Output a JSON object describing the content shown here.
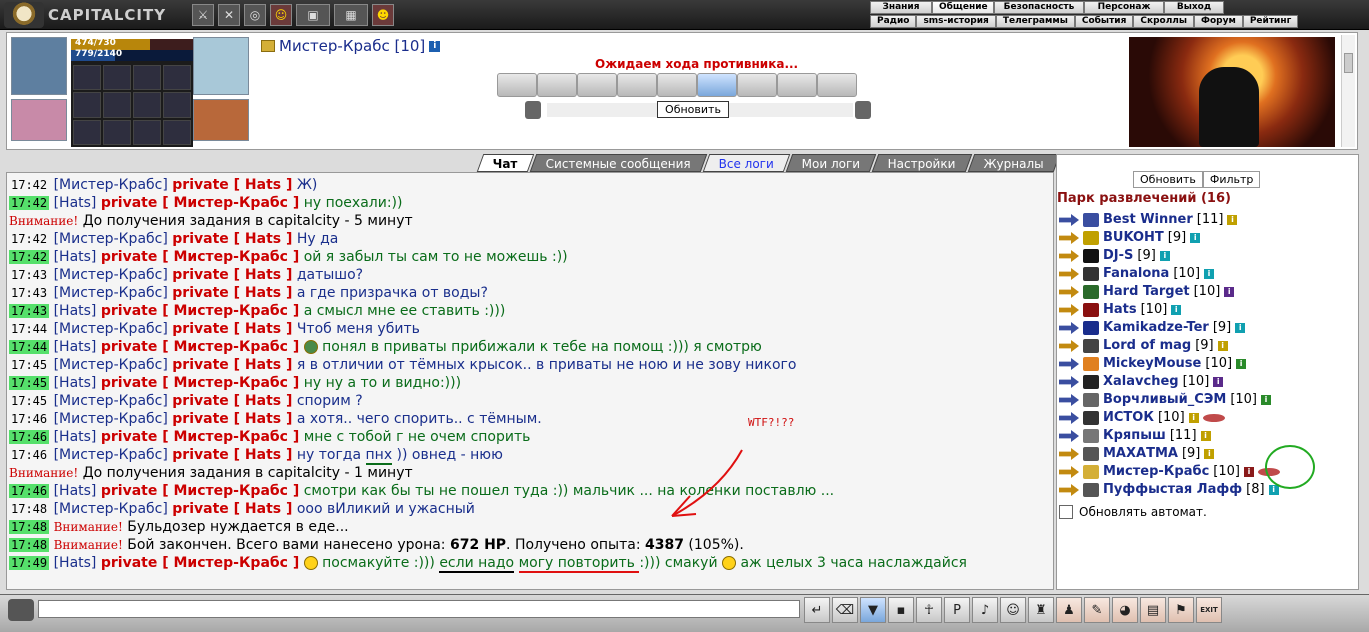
{
  "app": {
    "title": "CAPITALCITY"
  },
  "top_icons": [
    "sword-icon",
    "swords-icon",
    "wheel-icon",
    "smile-icon",
    "portrait-icon",
    "map-icon",
    "character-icon"
  ],
  "nav_row1": [
    {
      "label": "Знания"
    },
    {
      "label": "Общение",
      "active": true
    },
    {
      "label": "Безопасность"
    },
    {
      "label": "Персонаж"
    },
    {
      "label": "Выход"
    }
  ],
  "nav_row2": [
    {
      "label": "Радио"
    },
    {
      "label": "sms-история"
    },
    {
      "label": "Телеграммы"
    },
    {
      "label": "События"
    },
    {
      "label": "Скроллы"
    },
    {
      "label": "Форум"
    },
    {
      "label": "Рейтинг"
    }
  ],
  "character": {
    "hp": "474/730",
    "hp_fraction": 0.65,
    "mp": "779/2140",
    "mp_fraction": 0.36,
    "nick": "Мистер-Крабс [10]",
    "info": "i"
  },
  "battle": {
    "status": "Ожидаем хода противника...",
    "refresh_label": "Обновить"
  },
  "tabs": [
    {
      "label": "Чат",
      "active": true
    },
    {
      "label": "Системные сообщения"
    },
    {
      "label": "Все логи",
      "blue": true
    },
    {
      "label": "Мои логи"
    },
    {
      "label": "Настройки"
    },
    {
      "label": "Журналы"
    }
  ],
  "chat": [
    {
      "type": "msg",
      "time": "17:42",
      "hl": false,
      "from": "[Мистер-Крабс]",
      "to": "private [ Hats ]",
      "text": "Ж)",
      "color": "blue"
    },
    {
      "type": "msg",
      "time": "17:42",
      "hl": true,
      "from": "[Hats]",
      "to": "private [ Мистер-Крабс ]",
      "text": "ну поехали:))",
      "color": "green"
    },
    {
      "type": "sys",
      "attn": "Внимание!",
      "text": "До получения задания в capitalcity - 5 минут"
    },
    {
      "type": "msg",
      "time": "17:42",
      "hl": false,
      "from": "[Мистер-Крабс]",
      "to": "private [ Hats ]",
      "text": "Ну да",
      "color": "blue"
    },
    {
      "type": "msg",
      "time": "17:42",
      "hl": true,
      "from": "[Hats]",
      "to": "private [ Мистер-Крабс ]",
      "text": "ой я забыл ты сам то не можешь :))",
      "color": "green"
    },
    {
      "type": "msg",
      "time": "17:43",
      "hl": false,
      "from": "[Мистер-Крабс]",
      "to": "private [ Hats ]",
      "text": "датышо?",
      "color": "blue"
    },
    {
      "type": "msg",
      "time": "17:43",
      "hl": false,
      "from": "[Мистер-Крабс]",
      "to": "private [ Hats ]",
      "text": "а где призрачка от воды?",
      "color": "blue"
    },
    {
      "type": "msg",
      "time": "17:43",
      "hl": true,
      "from": "[Hats]",
      "to": "private [ Мистер-Крабс ]",
      "text": "а смысл мне ее ставить :)))",
      "color": "green"
    },
    {
      "type": "msg",
      "time": "17:44",
      "hl": false,
      "from": "[Мистер-Крабс]",
      "to": "private [ Hats ]",
      "text": "Чтоб меня убить",
      "color": "blue"
    },
    {
      "type": "msg",
      "time": "17:44",
      "hl": true,
      "from": "[Hats]",
      "to": "private [ Мистер-Крабс ]",
      "text": "понял в приваты прибижали к тебе на помощ :))) я смотрю",
      "color": "green",
      "emo": "dark"
    },
    {
      "type": "msg",
      "time": "17:45",
      "hl": false,
      "from": "[Мистер-Крабс]",
      "to": "private [ Hats ]",
      "text": "я в отличии от тёмных крысок.. в приваты не ною и не зову никого",
      "color": "blue"
    },
    {
      "type": "msg",
      "time": "17:45",
      "hl": true,
      "from": "[Hats]",
      "to": "private [ Мистер-Крабс ]",
      "text": "ну ну а то и видно:)))",
      "color": "green"
    },
    {
      "type": "msg",
      "time": "17:45",
      "hl": false,
      "from": "[Мистер-Крабс]",
      "to": "private [ Hats ]",
      "text": "спорим ?",
      "color": "blue"
    },
    {
      "type": "msg",
      "time": "17:46",
      "hl": false,
      "from": "[Мистер-Крабс]",
      "to": "private [ Hats ]",
      "text": "а хотя.. чего спорить.. с тёмным.",
      "color": "blue"
    },
    {
      "type": "msg",
      "time": "17:46",
      "hl": true,
      "from": "[Hats]",
      "to": "private [ Мистер-Крабс ]",
      "text": "мне с тобой г не очем спорить",
      "color": "green"
    },
    {
      "type": "msg",
      "time": "17:46",
      "hl": false,
      "from": "[Мистер-Крабс]",
      "to": "private [ Hats ]",
      "text_pre": "ну тогда ",
      "text_u": "пнх",
      "text_post": " )) овнед - нюю",
      "u": "green",
      "color": "blue"
    },
    {
      "type": "sys",
      "attn": "Внимание!",
      "text": "До получения задания в capitalcity - 1 минут"
    },
    {
      "type": "msg",
      "time": "17:46",
      "hl": true,
      "from": "[Hats]",
      "to": "private [ Мистер-Крабс ]",
      "text": "смотри как бы ты не пошел туда :)) мальчик ... на коленки поставлю ...",
      "color": "green"
    },
    {
      "type": "msg",
      "time": "17:48",
      "hl": false,
      "from": "[Мистер-Крабс]",
      "to": "private [ Hats ]",
      "text": "ооо вИликий и ужасный",
      "color": "blue"
    },
    {
      "type": "warn",
      "time": "17:48",
      "attn": "Внимание!",
      "text": "Бульдозер нуждается в еде..."
    },
    {
      "type": "battle",
      "time": "17:48",
      "attn": "Внимание!",
      "text_pre": "Бой закончен. Всего вами нанесено урона: ",
      "dmg": "672 HP",
      "text_mid": ". Получено опыта: ",
      "exp": "4387",
      "text_post": " (105%)."
    },
    {
      "type": "last",
      "time": "17:49",
      "from": "[Hats]",
      "to": "private [ Мистер-Крабс ]",
      "p1": " посмакуйте :))) ",
      "p2": "если надо",
      "p3": " ",
      "p4": "могу повторить ",
      "p5": ":))) смакуй ",
      "p6": " аж целых 3 часа наслаждайся"
    }
  ],
  "annotation": {
    "text": "WTF?!??"
  },
  "right_panel": {
    "refresh_label": "Обновить",
    "filter_label": "Фильтр",
    "room_title": "Парк развлечений (16)",
    "auto_refresh_label": "Обновлять автомат.",
    "users": [
      {
        "name": "Best Winner",
        "level": "[11]",
        "arrow": "blue",
        "badge": "y"
      },
      {
        "name": "BUKOHT",
        "level": "[9]",
        "arrow": "gold",
        "badge": "c"
      },
      {
        "name": "DJ-S",
        "level": "[9]",
        "arrow": "gold",
        "badge": "c"
      },
      {
        "name": "Fanalona",
        "level": "[10]",
        "arrow": "gold",
        "badge": "c"
      },
      {
        "name": "Hard Target",
        "level": "[10]",
        "arrow": "gold",
        "badge": "p"
      },
      {
        "name": "Hats",
        "level": "[10]",
        "arrow": "gold",
        "badge": "c"
      },
      {
        "name": "Kamikadze-Ter",
        "level": "[9]",
        "arrow": "blue",
        "badge": "c"
      },
      {
        "name": "Lord of mag",
        "level": "[9]",
        "arrow": "gold",
        "badge": "y"
      },
      {
        "name": "MickeyMouse",
        "level": "[10]",
        "arrow": "blue",
        "badge": "g"
      },
      {
        "name": "Xalavcheg",
        "level": "[10]",
        "arrow": "blue",
        "badge": "p"
      },
      {
        "name": "Ворчливый_СЭМ",
        "level": "[10]",
        "arrow": "blue",
        "badge": "g"
      },
      {
        "name": "ИСТОК",
        "level": "[10]",
        "arrow": "blue",
        "badge": "y"
      },
      {
        "name": "Кряпыш",
        "level": "[11]",
        "arrow": "blue",
        "badge": "y"
      },
      {
        "name": "МАХАТМА",
        "level": "[9]",
        "arrow": "gold",
        "badge": "y"
      },
      {
        "name": "Мистер-Крабс",
        "level": "[10]",
        "arrow": "gold",
        "badge": "r"
      },
      {
        "name": "Пуффыстая Лафф",
        "level": "[8]",
        "arrow": "gold",
        "badge": "c"
      }
    ]
  },
  "bottom_icons": [
    "send-icon",
    "eraser-icon",
    "filter-icon",
    "save-icon",
    "fight-icon",
    "translit-icon",
    "sound-icon",
    "emoticons-icon",
    "clan-icon",
    "inventory-icon",
    "quests-icon",
    "pet-icon",
    "gifts-icon",
    "flag-icon",
    "exit-icon"
  ],
  "bottom_exit_label": "EXIT"
}
